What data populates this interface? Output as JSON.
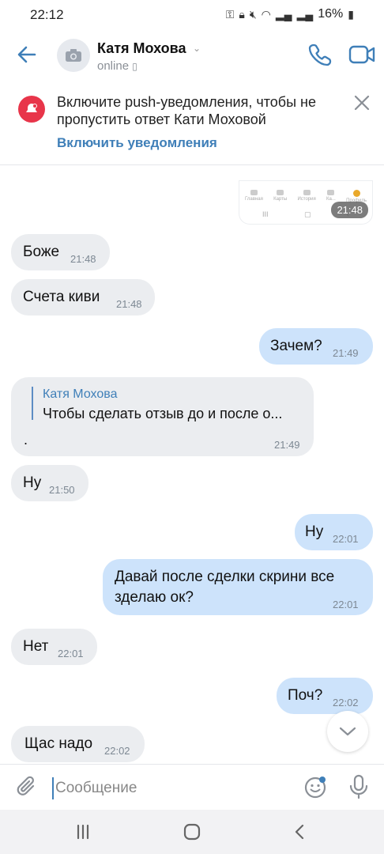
{
  "status_bar": {
    "time": "22:12",
    "battery": "16%"
  },
  "header": {
    "contact_name": "Катя Мохова",
    "contact_status": "online"
  },
  "banner": {
    "text": "Включите push-уведомления, чтобы не пропустить ответ Кати Моховой",
    "link": "Включить уведомления"
  },
  "attachment": {
    "time": "21:48",
    "tabs": [
      "Главная",
      "Карты",
      "История",
      "Ка...",
      "Профиль"
    ]
  },
  "messages": [
    {
      "dir": "in",
      "text": "Боже",
      "time": "21:48"
    },
    {
      "dir": "in",
      "text": "Счета киви",
      "time": "21:48"
    },
    {
      "dir": "out",
      "text": "Зачем?",
      "time": "21:49"
    },
    {
      "dir": "in",
      "reply_name": "Катя Мохова",
      "reply_text": "Чтобы сделать отзыв до и после о...",
      "text": ".",
      "time": "21:49"
    },
    {
      "dir": "in",
      "text": "Ну",
      "time": "21:50"
    },
    {
      "dir": "out",
      "text": "Ну",
      "time": "22:01"
    },
    {
      "dir": "out",
      "text_line1": "Давай после сделки скрини все",
      "text_line2": "зделаю ок?",
      "time": "22:01"
    },
    {
      "dir": "in",
      "text": "Нет",
      "time": "22:01"
    },
    {
      "dir": "out",
      "text": "Поч?",
      "time": "22:02"
    },
    {
      "dir": "in",
      "text": "Щас надо",
      "time": "22:02"
    }
  ],
  "input": {
    "placeholder": "Сообщение"
  },
  "colors": {
    "accent": "#3f7fb8",
    "incoming": "#ebedf0",
    "outgoing": "#cde3fb",
    "bell": "#e8354a"
  }
}
